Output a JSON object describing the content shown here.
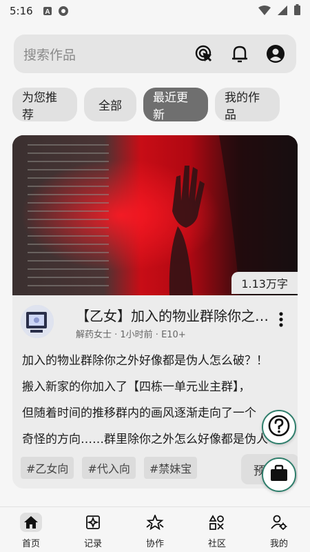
{
  "status_bar": {
    "time": "5:16"
  },
  "search": {
    "placeholder": "搜索作品",
    "icons": [
      "tap-icon",
      "bell-icon",
      "account-icon"
    ]
  },
  "filters": [
    {
      "label": "为您推荐",
      "active": false
    },
    {
      "label": "全部",
      "active": false
    },
    {
      "label": "最近更新",
      "active": true
    },
    {
      "label": "我的作品",
      "active": false
    }
  ],
  "card": {
    "word_count": "1.13万字",
    "title": "【乙女】加入的物业群除你之外好像都是伪人怎么破？",
    "meta": "解药女士 · 1小时前 · E10+",
    "excerpt": [
      "加入的物业群除你之外好像都是伪人怎么破？！",
      "搬入新家的你加入了【四栋一单元业主群】，",
      "但随着时间的推移群内的画风逐渐走向了一个",
      "奇怪的方向……群里除你之外怎么好像都是伪人"
    ],
    "tags": [
      "#乙女向",
      "#代入向",
      "#禁妹宝"
    ],
    "preview_label": "预览"
  },
  "fabs": [
    "help-icon",
    "briefcase-icon"
  ],
  "nav": [
    {
      "label": "首页",
      "icon": "home-icon",
      "active": true
    },
    {
      "label": "记录",
      "icon": "record-icon",
      "active": false
    },
    {
      "label": "协作",
      "icon": "collab-icon",
      "active": false
    },
    {
      "label": "社区",
      "icon": "community-icon",
      "active": false
    },
    {
      "label": "我的",
      "icon": "profile-icon",
      "active": false
    }
  ],
  "colors": {
    "accent": "#2e7e6b",
    "active_chip": "#6f6f6f",
    "cover_red": "#d0101c"
  }
}
